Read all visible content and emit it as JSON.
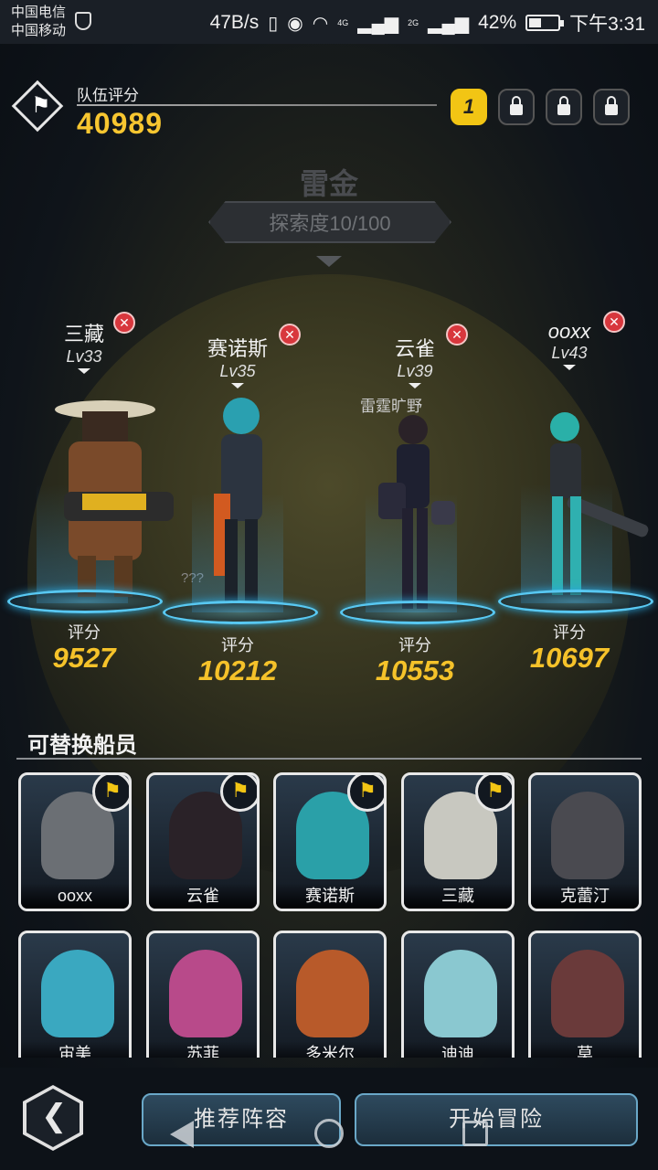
{
  "status_bar": {
    "carrier1": "中国电信",
    "carrier2": "中国移动",
    "speed": "47B/s",
    "signal_4g": "4G",
    "signal_2g": "2G",
    "battery": "42%",
    "battery_level": 0.42,
    "time": "下午3:31"
  },
  "team": {
    "label": "队伍评分",
    "score": "40989",
    "slots": [
      {
        "label": "1",
        "locked": false
      },
      {
        "label": "",
        "locked": true
      },
      {
        "label": "",
        "locked": true
      },
      {
        "label": "",
        "locked": true
      }
    ]
  },
  "area": {
    "name": "雷金",
    "explore": "探索度10/100"
  },
  "crew": [
    {
      "name": "三藏",
      "level": "Lv33",
      "score_label": "评分",
      "score": "9527"
    },
    {
      "name": "赛诺斯",
      "level": "Lv35",
      "score_label": "评分",
      "score": "10212"
    },
    {
      "name": "云雀",
      "level": "Lv39",
      "score_label": "评分",
      "score": "10553"
    },
    {
      "name": "ooxx",
      "level": "Lv43",
      "score_label": "评分",
      "score": "10697"
    }
  ],
  "scene_text": {
    "location": "雷霆旷野",
    "unknown": "???"
  },
  "roster": {
    "title": "可替换船员",
    "members": [
      {
        "name": "ooxx",
        "in_team": true
      },
      {
        "name": "云雀",
        "in_team": true
      },
      {
        "name": "赛诺斯",
        "in_team": true
      },
      {
        "name": "三藏",
        "in_team": true
      },
      {
        "name": "克蕾汀",
        "in_team": false
      },
      {
        "name": "宙美",
        "in_team": false
      },
      {
        "name": "苏菲",
        "in_team": false
      },
      {
        "name": "多米尔",
        "in_team": false
      },
      {
        "name": "迪迪",
        "in_team": false
      },
      {
        "name": "莫",
        "in_team": false
      }
    ]
  },
  "buttons": {
    "recommend": "推荐阵容",
    "start": "开始冒险"
  },
  "colors": {
    "score_gold": "#f5c22a",
    "pad_glow": "#58c8f2",
    "remove_red": "#d8373d",
    "slot_yellow": "#f2c514"
  }
}
